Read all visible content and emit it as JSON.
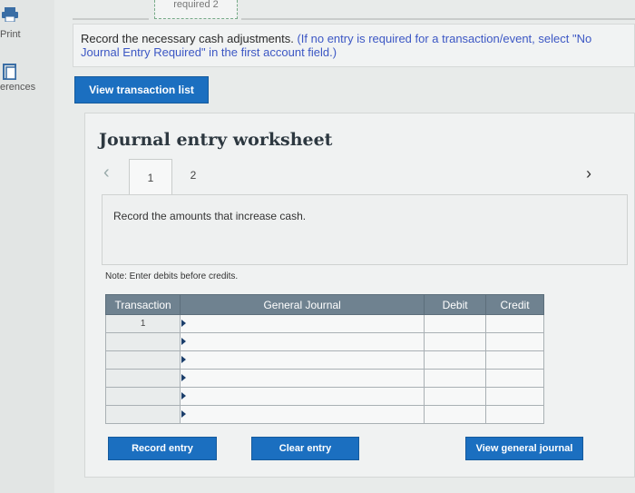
{
  "sidebar": {
    "print_label": "Print",
    "references_label": "erences"
  },
  "top_tabs": {
    "tab2_label": "required 2"
  },
  "instruction": {
    "main_text": "Record the necessary cash adjustments.",
    "hint_text": "(If no entry is required for a transaction/event, select \"No Journal Entry Required\" in the first account field.)"
  },
  "buttons": {
    "view_transaction_list": "View transaction list",
    "record_entry": "Record entry",
    "clear_entry": "Clear entry",
    "view_general_journal": "View general journal"
  },
  "worksheet": {
    "title": "Journal entry worksheet",
    "tabs": [
      {
        "label": "1"
      },
      {
        "label": "2"
      }
    ],
    "prompt": "Record the amounts that increase cash.",
    "note": "Note: Enter debits before credits."
  },
  "journal_table": {
    "headers": [
      "Transaction",
      "General Journal",
      "Debit",
      "Credit"
    ],
    "rows": [
      {
        "transaction": "1",
        "account": "",
        "debit": "",
        "credit": ""
      },
      {
        "transaction": "",
        "account": "",
        "debit": "",
        "credit": ""
      },
      {
        "transaction": "",
        "account": "",
        "debit": "",
        "credit": ""
      },
      {
        "transaction": "",
        "account": "",
        "debit": "",
        "credit": ""
      },
      {
        "transaction": "",
        "account": "",
        "debit": "",
        "credit": ""
      },
      {
        "transaction": "",
        "account": "",
        "debit": "",
        "credit": ""
      }
    ]
  },
  "icons": {
    "print": "printer-icon",
    "references": "book-icon",
    "prev": "chevron-left-icon",
    "next": "chevron-right-icon"
  },
  "colors": {
    "primary_button": "#1b6fc0",
    "table_header": "#6f8290",
    "hint_text": "#3c57c4"
  }
}
